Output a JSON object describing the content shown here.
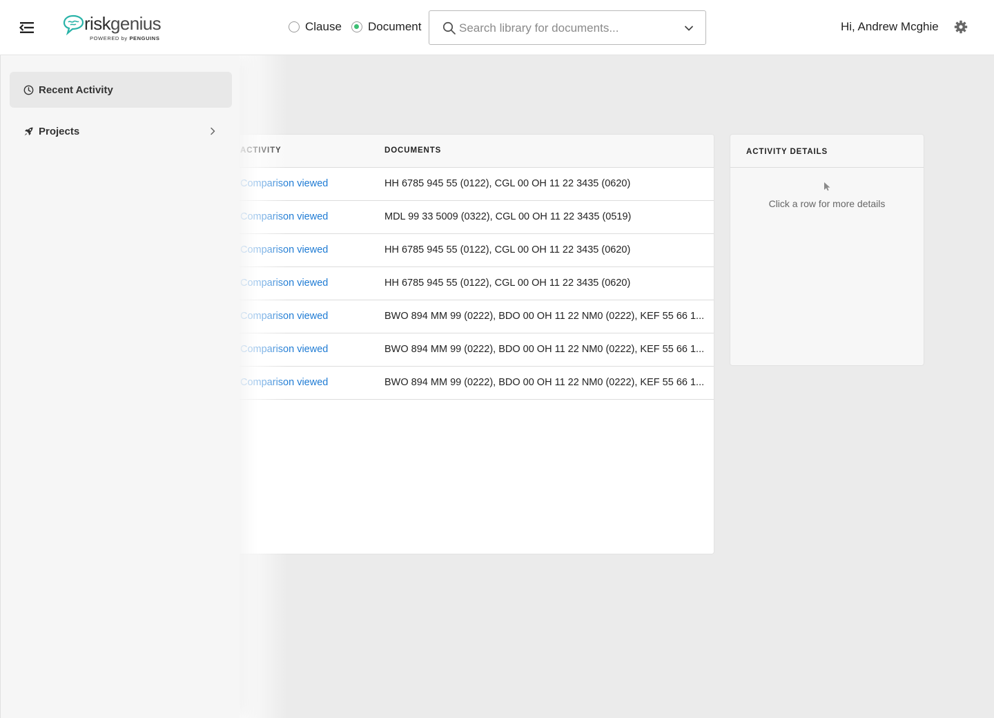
{
  "header": {
    "logo_text_bold": "risk",
    "logo_text_light": "genius",
    "logo_sub_prefix": "POWERED by ",
    "logo_sub_brand": "PENGUINS",
    "mode_options": [
      {
        "label": "Clause",
        "selected": false
      },
      {
        "label": "Document",
        "selected": true
      }
    ],
    "search": {
      "placeholder": "Search library for documents...",
      "value": ""
    },
    "greeting": "Hi, Andrew Mcghie"
  },
  "sidebar": {
    "items": [
      {
        "label": "Recent Activity",
        "icon": "clock-icon",
        "active": true
      },
      {
        "label": "Projects",
        "icon": "rocket-icon",
        "active": false,
        "has_submenu": true
      }
    ]
  },
  "table": {
    "columns": [
      "ACTIVITY",
      "DOCUMENTS"
    ],
    "rows": [
      {
        "activity": "Comparison viewed",
        "documents": "HH 6785 945 55 (0122), CGL 00 OH 11 22 3435 (0620)"
      },
      {
        "activity": "Comparison viewed",
        "documents": "MDL 99 33 5009 (0322), CGL 00 OH 11 22 3435 (0519)"
      },
      {
        "activity": "Comparison viewed",
        "documents": "HH 6785 945 55 (0122), CGL 00 OH 11 22 3435 (0620)"
      },
      {
        "activity": "Comparison viewed",
        "documents": "HH 6785 945 55 (0122), CGL 00 OH 11 22 3435 (0620)"
      },
      {
        "activity": "Comparison viewed",
        "documents": "BWO 894 MM 99 (0222), BDO 00 OH 11 22 NM0 (0222), KEF 55 66 1..."
      },
      {
        "activity": "Comparison viewed",
        "documents": "BWO 894 MM 99 (0222), BDO 00 OH 11 22 NM0 (0222), KEF 55 66 1..."
      },
      {
        "activity": "Comparison viewed",
        "documents": "BWO 894 MM 99 (0222), BDO 00 OH 11 22 NM0 (0222), KEF 55 66 1..."
      }
    ]
  },
  "details": {
    "title": "ACTIVITY DETAILS",
    "empty_text": "Click a row for more details"
  },
  "colors": {
    "accent_link": "#1e7bd4",
    "radio_selected": "#3cbf74",
    "logo_teal": "#29b3a8"
  }
}
